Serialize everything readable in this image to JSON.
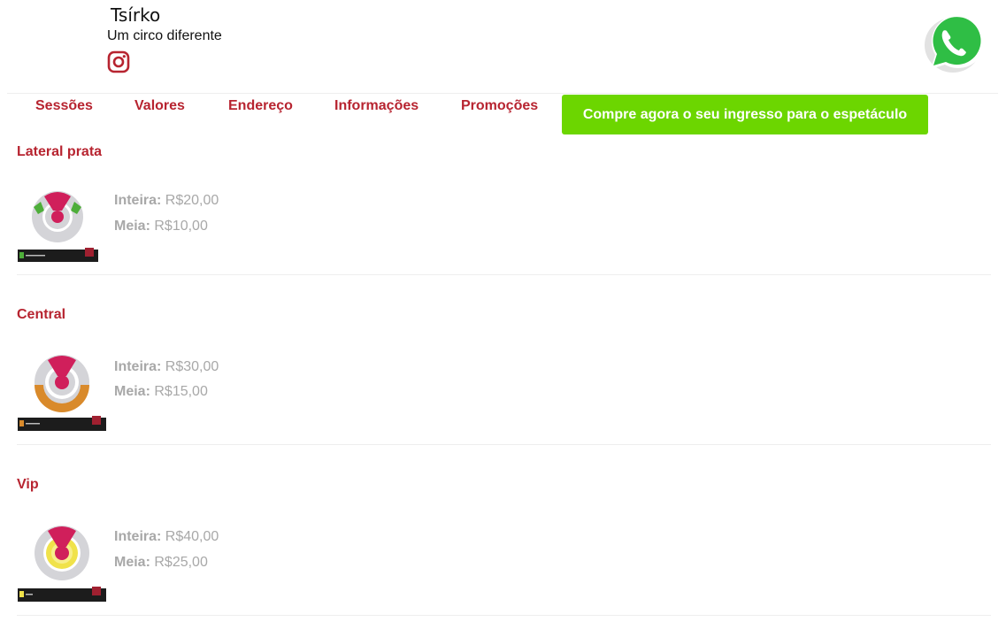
{
  "brand": {
    "title": "Tsírko",
    "subtitle": "Um circo diferente"
  },
  "icons": {
    "instagram": "instagram-icon",
    "whatsapp": "whatsapp-icon"
  },
  "nav": {
    "items": [
      "Sessões",
      "Valores",
      "Endereço",
      "Informações",
      "Promoções"
    ]
  },
  "cta": {
    "label": "Compre agora o seu ingresso para o espetáculo"
  },
  "labels": {
    "inteira": "Inteira:",
    "meia": "Meia:"
  },
  "sections": [
    {
      "title": "Lateral prata",
      "inteira": "R$20,00",
      "meia": "R$10,00"
    },
    {
      "title": "Central",
      "inteira": "R$30,00",
      "meia": "R$15,00"
    },
    {
      "title": "Vip",
      "inteira": "R$40,00",
      "meia": "R$25,00"
    }
  ],
  "colors": {
    "accent": "#b72430",
    "cta": "#6cd600",
    "price": "#a8a8a8",
    "stage": "#d01f5b",
    "lateral": "#4eae3a",
    "central": "#d98a2b",
    "vip": "#f0e24a"
  }
}
